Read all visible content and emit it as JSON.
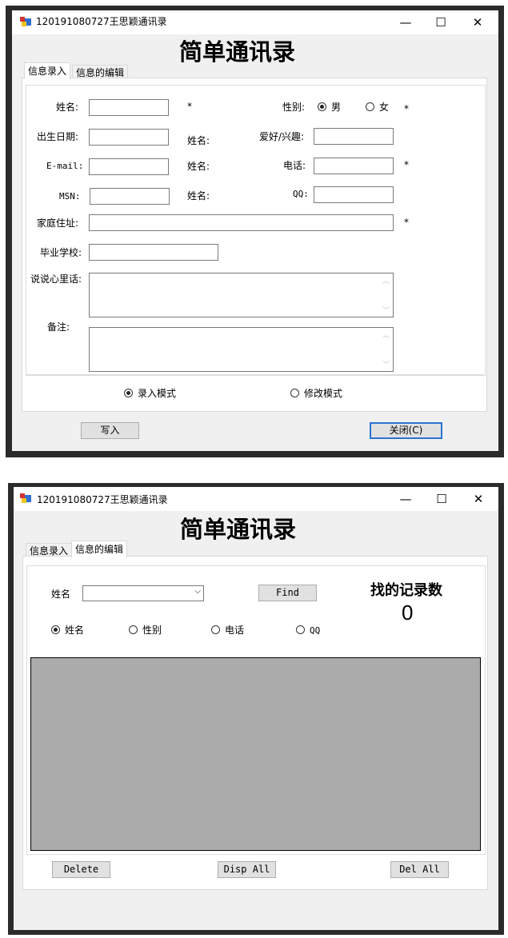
{
  "windows": [
    {
      "title": "120191080727王思颖通讯录",
      "controls": {
        "minimize": "—",
        "maximize": "☐",
        "close": "✕"
      },
      "heading": "简单通讯录",
      "tabs": [
        {
          "label": "信息录入",
          "active": true
        },
        {
          "label": "信息的编辑",
          "active": false
        }
      ],
      "form": {
        "name_label": "姓名:",
        "name_required": "*",
        "gender_label": "性别:",
        "gender_options": [
          "男",
          "女"
        ],
        "gender_selected": "男",
        "gender_required": "*",
        "birth_label": "出生日期:",
        "birth_suffix": "姓名:",
        "hobby_label": "爱好/兴趣:",
        "email_label": "E-mail:",
        "email_suffix": "姓名:",
        "phone_label": "电话:",
        "phone_required": "*",
        "msn_label": "MSN:",
        "msn_suffix": "姓名:",
        "qq_label": "QQ:",
        "address_label": "家庭住址:",
        "address_required": "*",
        "school_label": "毕业学校:",
        "heart_label": "说说心里话:",
        "notes_label": "备注:"
      },
      "modes": {
        "entry": "录入模式",
        "edit": "修改模式",
        "selected": "录入模式"
      },
      "buttons": {
        "write": "写入",
        "close": "关闭(C)"
      }
    },
    {
      "title": "120191080727王思颖通讯录",
      "controls": {
        "minimize": "—",
        "maximize": "☐",
        "close": "✕"
      },
      "heading": "简单通讯录",
      "tabs": [
        {
          "label": "信息录入",
          "active": false
        },
        {
          "label": "信息的编辑",
          "active": true
        }
      ],
      "search": {
        "field_label": "姓名",
        "combo_value": "",
        "find_button": "Find",
        "count_title": "找的记录数",
        "count_value": "0",
        "criteria": [
          "姓名",
          "性别",
          "电话",
          "QQ"
        ],
        "criteria_selected": "姓名"
      },
      "buttons": {
        "delete": "Delete",
        "disp_all": "Disp All",
        "del_all": "Del All"
      }
    }
  ]
}
